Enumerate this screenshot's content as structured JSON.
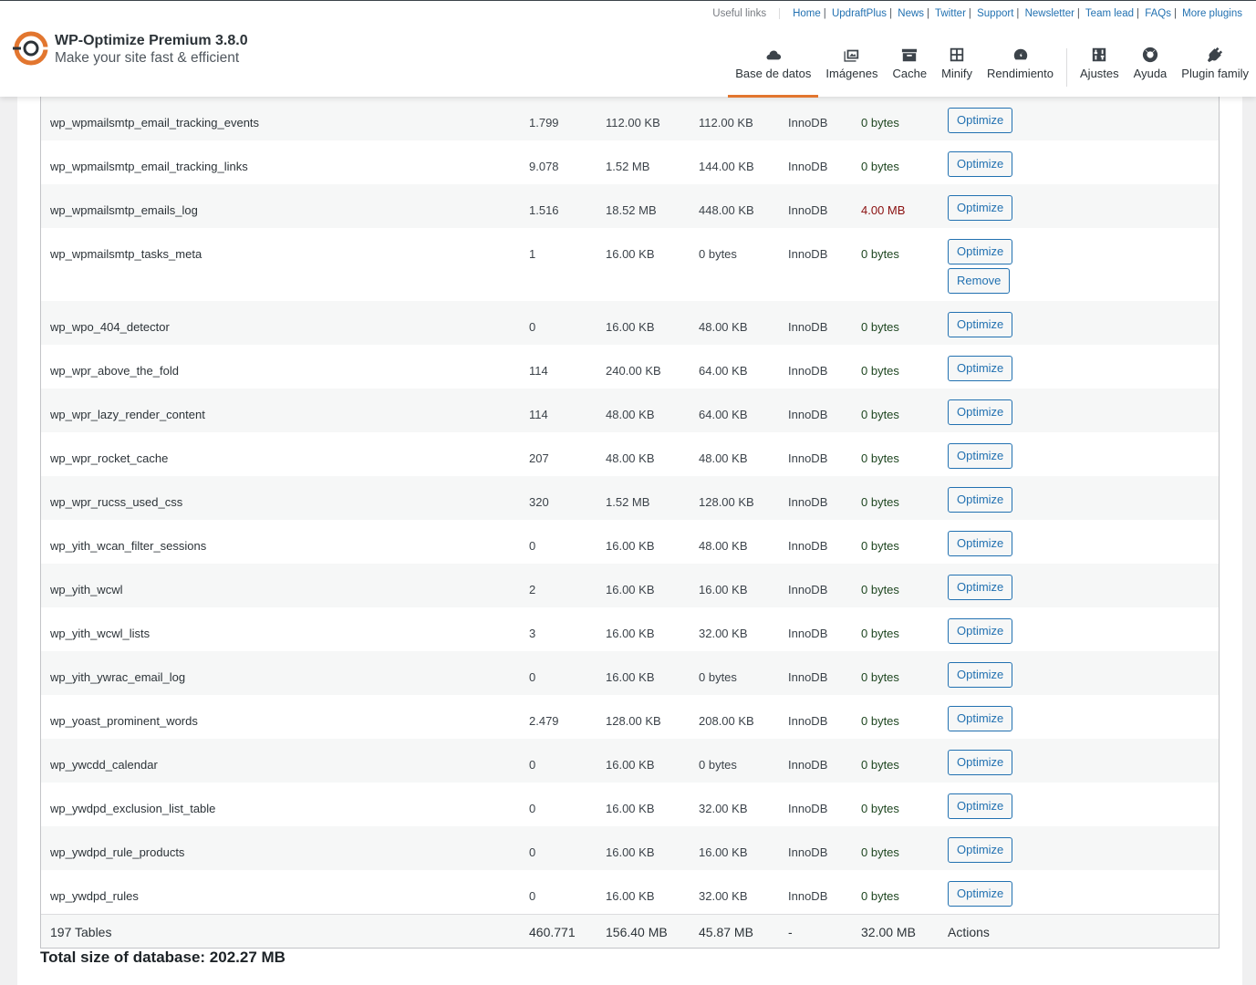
{
  "brand": {
    "title": "WP-Optimize Premium 3.8.0",
    "tagline": "Make your site fast & efficient"
  },
  "useful_links": {
    "label": "Useful links",
    "links": [
      "Home",
      "UpdraftPlus",
      "News",
      "Twitter",
      "Support",
      "Newsletter",
      "Team lead",
      "FAQs",
      "More plugins"
    ]
  },
  "nav": {
    "items": [
      {
        "label": "Base de datos",
        "icon": "cloud-icon"
      },
      {
        "label": "Imágenes",
        "icon": "images-icon"
      },
      {
        "label": "Cache",
        "icon": "archive-icon"
      },
      {
        "label": "Minify",
        "icon": "grid-icon"
      },
      {
        "label": "Rendimiento",
        "icon": "dashboard-icon"
      },
      {
        "label": "Ajustes",
        "icon": "settings-icon"
      },
      {
        "label": "Ayuda",
        "icon": "lifebuoy-icon"
      },
      {
        "label": "Plugin family",
        "icon": "plugin-icon"
      }
    ],
    "active": "Base de datos"
  },
  "table": {
    "rows": [
      {
        "name": "wp_wpmailsmtp_email_tracking_events",
        "records": "1.799",
        "data_size": "112.00 KB",
        "index_size": "112.00 KB",
        "type": "InnoDB",
        "overhead": "0 bytes",
        "actions": [
          "Optimize"
        ]
      },
      {
        "name": "wp_wpmailsmtp_email_tracking_links",
        "records": "9.078",
        "data_size": "1.52 MB",
        "index_size": "144.00 KB",
        "type": "InnoDB",
        "overhead": "0 bytes",
        "actions": [
          "Optimize"
        ]
      },
      {
        "name": "wp_wpmailsmtp_emails_log",
        "records": "1.516",
        "data_size": "18.52 MB",
        "index_size": "448.00 KB",
        "type": "InnoDB",
        "overhead": "4.00 MB",
        "overhead_warn": true,
        "actions": [
          "Optimize"
        ]
      },
      {
        "name": "wp_wpmailsmtp_tasks_meta",
        "records": "1",
        "data_size": "16.00 KB",
        "index_size": "0 bytes",
        "type": "InnoDB",
        "overhead": "0 bytes",
        "actions": [
          "Optimize",
          "Remove"
        ]
      },
      {
        "name": "wp_wpo_404_detector",
        "records": "0",
        "data_size": "16.00 KB",
        "index_size": "48.00 KB",
        "type": "InnoDB",
        "overhead": "0 bytes",
        "actions": [
          "Optimize"
        ]
      },
      {
        "name": "wp_wpr_above_the_fold",
        "records": "114",
        "data_size": "240.00 KB",
        "index_size": "64.00 KB",
        "type": "InnoDB",
        "overhead": "0 bytes",
        "actions": [
          "Optimize"
        ]
      },
      {
        "name": "wp_wpr_lazy_render_content",
        "records": "114",
        "data_size": "48.00 KB",
        "index_size": "64.00 KB",
        "type": "InnoDB",
        "overhead": "0 bytes",
        "actions": [
          "Optimize"
        ]
      },
      {
        "name": "wp_wpr_rocket_cache",
        "records": "207",
        "data_size": "48.00 KB",
        "index_size": "48.00 KB",
        "type": "InnoDB",
        "overhead": "0 bytes",
        "actions": [
          "Optimize"
        ]
      },
      {
        "name": "wp_wpr_rucss_used_css",
        "records": "320",
        "data_size": "1.52 MB",
        "index_size": "128.00 KB",
        "type": "InnoDB",
        "overhead": "0 bytes",
        "actions": [
          "Optimize"
        ]
      },
      {
        "name": "wp_yith_wcan_filter_sessions",
        "records": "0",
        "data_size": "16.00 KB",
        "index_size": "48.00 KB",
        "type": "InnoDB",
        "overhead": "0 bytes",
        "actions": [
          "Optimize"
        ]
      },
      {
        "name": "wp_yith_wcwl",
        "records": "2",
        "data_size": "16.00 KB",
        "index_size": "16.00 KB",
        "type": "InnoDB",
        "overhead": "0 bytes",
        "actions": [
          "Optimize"
        ]
      },
      {
        "name": "wp_yith_wcwl_lists",
        "records": "3",
        "data_size": "16.00 KB",
        "index_size": "32.00 KB",
        "type": "InnoDB",
        "overhead": "0 bytes",
        "actions": [
          "Optimize"
        ]
      },
      {
        "name": "wp_yith_ywrac_email_log",
        "records": "0",
        "data_size": "16.00 KB",
        "index_size": "0 bytes",
        "type": "InnoDB",
        "overhead": "0 bytes",
        "actions": [
          "Optimize"
        ]
      },
      {
        "name": "wp_yoast_prominent_words",
        "records": "2.479",
        "data_size": "128.00 KB",
        "index_size": "208.00 KB",
        "type": "InnoDB",
        "overhead": "0 bytes",
        "actions": [
          "Optimize"
        ]
      },
      {
        "name": "wp_ywcdd_calendar",
        "records": "0",
        "data_size": "16.00 KB",
        "index_size": "0 bytes",
        "type": "InnoDB",
        "overhead": "0 bytes",
        "actions": [
          "Optimize"
        ]
      },
      {
        "name": "wp_ywdpd_exclusion_list_table",
        "records": "0",
        "data_size": "16.00 KB",
        "index_size": "32.00 KB",
        "type": "InnoDB",
        "overhead": "0 bytes",
        "actions": [
          "Optimize"
        ]
      },
      {
        "name": "wp_ywdpd_rule_products",
        "records": "0",
        "data_size": "16.00 KB",
        "index_size": "16.00 KB",
        "type": "InnoDB",
        "overhead": "0 bytes",
        "actions": [
          "Optimize"
        ]
      },
      {
        "name": "wp_ywdpd_rules",
        "records": "0",
        "data_size": "16.00 KB",
        "index_size": "32.00 KB",
        "type": "InnoDB",
        "overhead": "0 bytes",
        "actions": [
          "Optimize"
        ]
      }
    ],
    "footer": {
      "tables": "197 Tables",
      "records": "460.771",
      "data_size": "156.40 MB",
      "index_size": "45.87 MB",
      "type": "-",
      "overhead": "32.00 MB",
      "actions": "Actions"
    }
  },
  "total": "Total size of database: 202.27 MB",
  "colors": {
    "accent": "#e2762f",
    "link": "#2271b1",
    "ok": "#1e4620",
    "warn": "#8a1010"
  }
}
